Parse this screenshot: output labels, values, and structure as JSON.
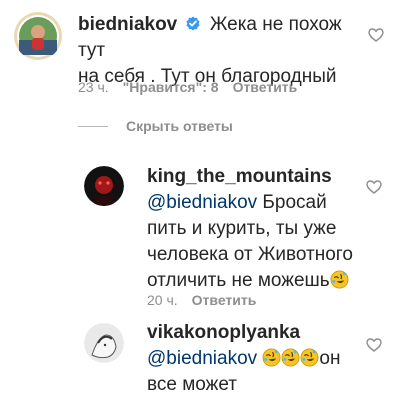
{
  "comment": {
    "username": "biedniakov",
    "verified": true,
    "text_line1": "Жека не похож тут",
    "text_line2": "на себя . Тут он благородный",
    "time": "23 ч.",
    "likes": "\"Нравится\": 8",
    "reply_label": "Ответить"
  },
  "hide_replies_label": "Скрыть ответы",
  "replies": [
    {
      "username": "king_the_mountains",
      "mention": "@biedniakov",
      "text_line1_rest": " Бросай",
      "text_line2": "пить и курить, ты уже",
      "text_line3": "человека от Животного",
      "text_line4": "отличить не можешь",
      "emoji": "rolling-on-floor-laughing",
      "time": "20 ч.",
      "reply_label": "Ответить"
    },
    {
      "username": "vikakonoplyanka",
      "mention": "@biedniakov",
      "emoji_count": 3,
      "text_line1_rest": "он",
      "text_line2": "все может"
    }
  ],
  "colors": {
    "text": "#262626",
    "secondary": "#8e8e8e",
    "mention": "#00376b",
    "verified": "#3897f0"
  }
}
